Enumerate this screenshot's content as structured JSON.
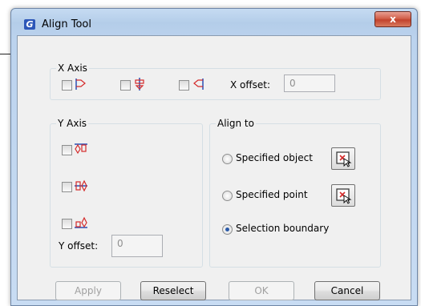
{
  "window": {
    "title": "Align Tool",
    "app_icon": "G",
    "close_label": "x"
  },
  "x_axis": {
    "label": "X Axis",
    "options": [
      {
        "icon": "align-left-icon"
      },
      {
        "icon": "align-center-vertical-icon"
      },
      {
        "icon": "align-right-icon"
      }
    ],
    "offset_label": "X offset:",
    "offset_value": "0"
  },
  "y_axis": {
    "label": "Y Axis",
    "options": [
      {
        "icon": "align-top-icon"
      },
      {
        "icon": "align-center-horizontal-icon"
      },
      {
        "icon": "align-bottom-icon"
      }
    ],
    "offset_label": "Y offset:",
    "offset_value": "0"
  },
  "align_to": {
    "label": "Align to",
    "options": [
      {
        "label": "Specified object",
        "selected": false
      },
      {
        "label": "Specified point",
        "selected": false
      },
      {
        "label": "Selection boundary",
        "selected": true
      }
    ]
  },
  "buttons": {
    "apply": "Apply",
    "reselect": "Reselect",
    "ok": "OK",
    "cancel": "Cancel"
  },
  "colors": {
    "icon_blue": "#2a4fb5",
    "icon_red": "#d42a2a"
  }
}
